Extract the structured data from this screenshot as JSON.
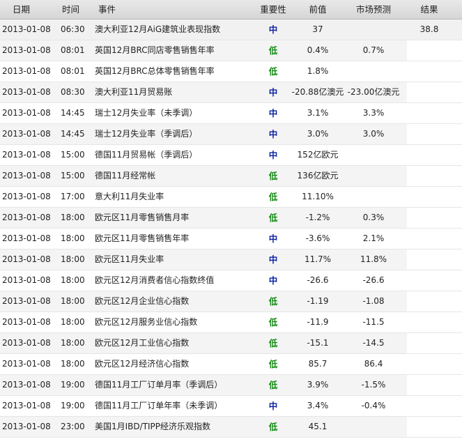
{
  "header": {
    "date": "日期",
    "time": "时间",
    "event": "事件",
    "importance": "重要性",
    "previous": "前值",
    "forecast": "市场预测",
    "result": "结果"
  },
  "rows": [
    {
      "date": "2013-01-08",
      "time": "06:30",
      "event": "澳大利亚12月AiG建筑业表现指数",
      "importance": "中",
      "level": "mid",
      "previous": "37",
      "forecast": "",
      "result": "38.8"
    },
    {
      "date": "2013-01-08",
      "time": "08:01",
      "event": "英国12月BRC同店零售销售年率",
      "importance": "低",
      "level": "low",
      "previous": "0.4%",
      "forecast": "0.7%",
      "result": ""
    },
    {
      "date": "2013-01-08",
      "time": "08:01",
      "event": "英国12月BRC总体零售销售年率",
      "importance": "低",
      "level": "low",
      "previous": "1.8%",
      "forecast": "",
      "result": ""
    },
    {
      "date": "2013-01-08",
      "time": "08:30",
      "event": "澳大利亚11月贸易账",
      "importance": "中",
      "level": "mid",
      "previous": "-20.88亿澳元",
      "forecast": "-23.00亿澳元",
      "result": ""
    },
    {
      "date": "2013-01-08",
      "time": "14:45",
      "event": "瑞士12月失业率（未季调）",
      "importance": "中",
      "level": "mid",
      "previous": "3.1%",
      "forecast": "3.3%",
      "result": ""
    },
    {
      "date": "2013-01-08",
      "time": "14:45",
      "event": "瑞士12月失业率（季调后）",
      "importance": "中",
      "level": "mid",
      "previous": "3.0%",
      "forecast": "3.0%",
      "result": ""
    },
    {
      "date": "2013-01-08",
      "time": "15:00",
      "event": "德国11月贸易帐（季调后）",
      "importance": "中",
      "level": "mid",
      "previous": "152亿欧元",
      "forecast": "",
      "result": ""
    },
    {
      "date": "2013-01-08",
      "time": "15:00",
      "event": "德国11月经常帐",
      "importance": "低",
      "level": "low",
      "previous": "136亿欧元",
      "forecast": "",
      "result": ""
    },
    {
      "date": "2013-01-08",
      "time": "17:00",
      "event": "意大利11月失业率",
      "importance": "低",
      "level": "low",
      "previous": "11.10%",
      "forecast": "",
      "result": ""
    },
    {
      "date": "2013-01-08",
      "time": "18:00",
      "event": "欧元区11月零售销售月率",
      "importance": "低",
      "level": "low",
      "previous": "-1.2%",
      "forecast": "0.3%",
      "result": ""
    },
    {
      "date": "2013-01-08",
      "time": "18:00",
      "event": "欧元区11月零售销售年率",
      "importance": "中",
      "level": "mid",
      "previous": "-3.6%",
      "forecast": "2.1%",
      "result": ""
    },
    {
      "date": "2013-01-08",
      "time": "18:00",
      "event": "欧元区11月失业率",
      "importance": "中",
      "level": "mid",
      "previous": "11.7%",
      "forecast": "11.8%",
      "result": ""
    },
    {
      "date": "2013-01-08",
      "time": "18:00",
      "event": "欧元区12月消费者信心指数终值",
      "importance": "中",
      "level": "mid",
      "previous": "-26.6",
      "forecast": "-26.6",
      "result": ""
    },
    {
      "date": "2013-01-08",
      "time": "18:00",
      "event": "欧元区12月企业信心指数",
      "importance": "低",
      "level": "low",
      "previous": "-1.19",
      "forecast": "-1.08",
      "result": ""
    },
    {
      "date": "2013-01-08",
      "time": "18:00",
      "event": "欧元区12月服务业信心指数",
      "importance": "低",
      "level": "low",
      "previous": "-11.9",
      "forecast": "-11.5",
      "result": ""
    },
    {
      "date": "2013-01-08",
      "time": "18:00",
      "event": "欧元区12月工业信心指数",
      "importance": "低",
      "level": "low",
      "previous": "-15.1",
      "forecast": "-14.5",
      "result": ""
    },
    {
      "date": "2013-01-08",
      "time": "18:00",
      "event": "欧元区12月经济信心指数",
      "importance": "低",
      "level": "low",
      "previous": "85.7",
      "forecast": "86.4",
      "result": ""
    },
    {
      "date": "2013-01-08",
      "time": "19:00",
      "event": "德国11月工厂订单月率（季调后）",
      "importance": "低",
      "level": "low",
      "previous": "3.9%",
      "forecast": "-1.5%",
      "result": ""
    },
    {
      "date": "2013-01-08",
      "time": "19:00",
      "event": "德国11月工厂订单年率（未季调）",
      "importance": "中",
      "level": "mid",
      "previous": "3.4%",
      "forecast": "-0.4%",
      "result": ""
    },
    {
      "date": "2013-01-08",
      "time": "23:00",
      "event": "美国1月IBD/TIPP经济乐观指数",
      "importance": "低",
      "level": "low",
      "previous": "45.1",
      "forecast": "",
      "result": ""
    }
  ],
  "colors": {
    "importance_mid": "#0a1fa0",
    "importance_low": "#168a16"
  }
}
